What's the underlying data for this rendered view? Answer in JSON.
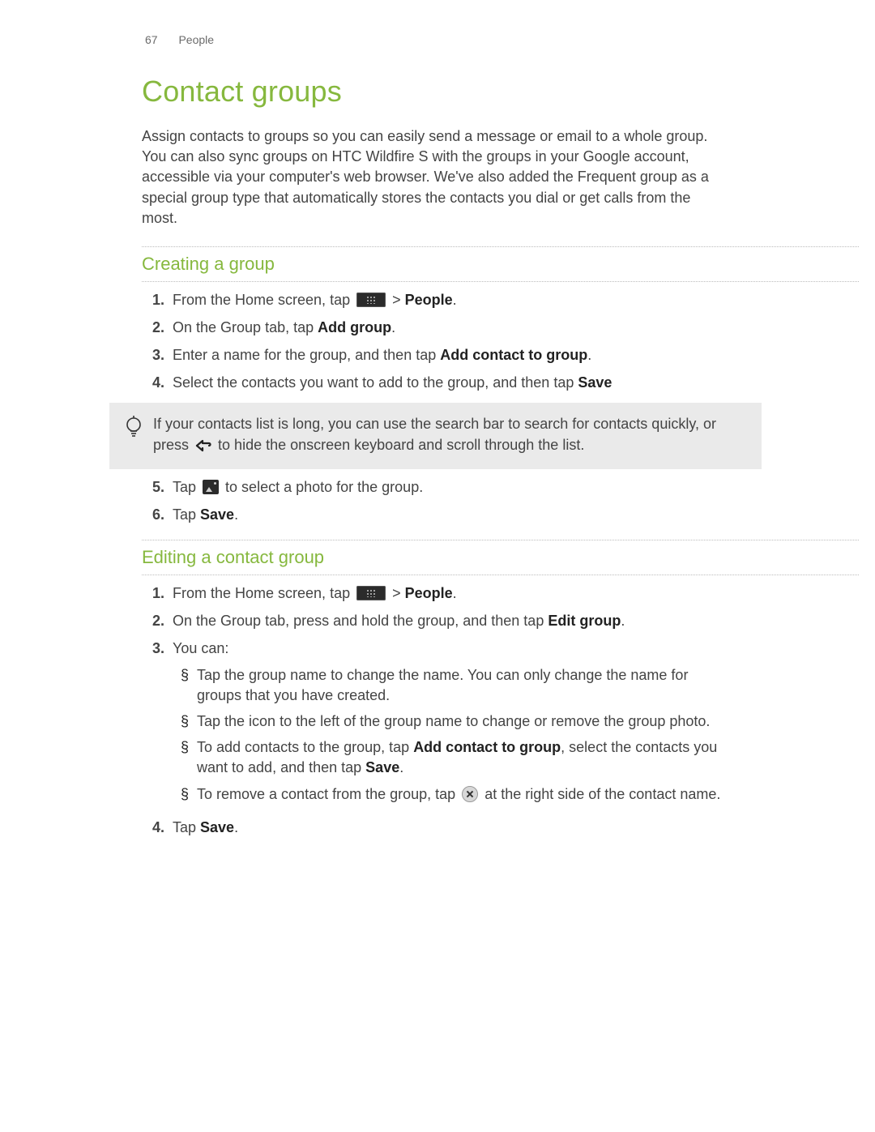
{
  "header": {
    "page_number": "67",
    "section": "People"
  },
  "title": "Contact groups",
  "intro": "Assign contacts to groups so you can easily send a message or email to a whole group. You can also sync groups on HTC Wildfire S with the groups in your Google account, accessible via your computer's web browser. We've also added the Frequent group as a special group type that automatically stores the contacts you dial or get calls from the most.",
  "sec1": {
    "heading": "Creating a group",
    "step1_a": "From the Home screen, tap ",
    "step1_b": " > ",
    "step1_people": "People",
    "step1_c": ".",
    "step2_a": "On the Group tab, tap ",
    "step2_add_group": "Add group",
    "step2_b": ".",
    "step3_a": "Enter a name for the group, and then tap ",
    "step3_add_contact": "Add contact to group",
    "step3_b": ".",
    "step4_a": "Select the contacts you want to add to the group, and then tap ",
    "step4_save": "Save",
    "tip_a": "If your contacts list is long, you can use the search bar to search for contacts quickly, or press ",
    "tip_b": " to hide the onscreen keyboard and scroll through the list.",
    "step5_a": "Tap ",
    "step5_b": " to select a photo for the group.",
    "step6_a": "Tap ",
    "step6_save": "Save",
    "step6_b": "."
  },
  "sec2": {
    "heading": "Editing a contact group",
    "step1_a": "From the Home screen, tap ",
    "step1_b": " > ",
    "step1_people": "People",
    "step1_c": ".",
    "step2_a": "On the Group tab, press and hold the group, and then tap ",
    "step2_edit": "Edit group",
    "step2_b": ".",
    "step3": "You can:",
    "b1": "Tap the group name to change the name. You can only change the name for groups that you have created.",
    "b2": "Tap the icon to the left of the group name to change or remove the group photo.",
    "b3_a": "To add contacts to the group, tap ",
    "b3_add": "Add contact to group",
    "b3_b": ", select the contacts you want to add, and then tap ",
    "b3_save": "Save",
    "b3_c": ".",
    "b4_a": "To remove a contact from the group, tap ",
    "b4_b": " at the right side of the contact name.",
    "step4_a": "Tap ",
    "step4_save": "Save",
    "step4_b": "."
  },
  "numbers": {
    "n1": "1.",
    "n2": "2.",
    "n3": "3.",
    "n4": "4.",
    "n5": "5.",
    "n6": "6."
  },
  "bullet": "§"
}
